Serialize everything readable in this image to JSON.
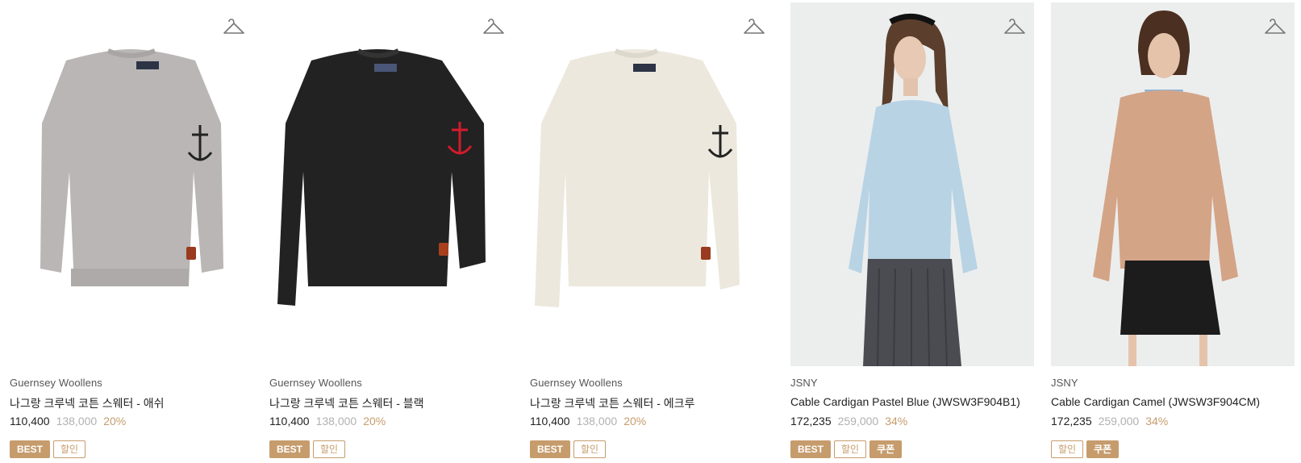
{
  "colors": {
    "accent": "#c69c6d",
    "muted": "#b1b1b1"
  },
  "products": [
    {
      "brand": "Guernsey Woollens",
      "name": "나그랑 크루넥 코튼 스웨터 - 애쉬",
      "price": "110,400",
      "original_price": "138,000",
      "discount": "20%",
      "tags": [
        {
          "label": "BEST",
          "style": "fill"
        },
        {
          "label": "할인",
          "style": "line"
        }
      ],
      "image": "grey-sweater-image",
      "wishlist_icon": "hanger-icon"
    },
    {
      "brand": "Guernsey Woollens",
      "name": "나그랑 크루넥 코튼 스웨터 - 블랙",
      "price": "110,400",
      "original_price": "138,000",
      "discount": "20%",
      "tags": [
        {
          "label": "BEST",
          "style": "fill"
        },
        {
          "label": "할인",
          "style": "line"
        }
      ],
      "image": "black-sweater-image",
      "wishlist_icon": "hanger-icon"
    },
    {
      "brand": "Guernsey Woollens",
      "name": "나그랑 크루넥 코튼 스웨터 - 에크루",
      "price": "110,400",
      "original_price": "138,000",
      "discount": "20%",
      "tags": [
        {
          "label": "BEST",
          "style": "fill"
        },
        {
          "label": "할인",
          "style": "line"
        }
      ],
      "image": "ecru-sweater-image",
      "wishlist_icon": "hanger-icon"
    },
    {
      "brand": "JSNY",
      "name": "Cable Cardigan Pastel Blue (JWSW3F904B1)",
      "price": "172,235",
      "original_price": "259,000",
      "discount": "34%",
      "tags": [
        {
          "label": "BEST",
          "style": "fill"
        },
        {
          "label": "할인",
          "style": "line"
        },
        {
          "label": "쿠폰",
          "style": "fill"
        }
      ],
      "image": "model-blue-cardigan-image",
      "wishlist_icon": "hanger-icon"
    },
    {
      "brand": "JSNY",
      "name": "Cable Cardigan Camel (JWSW3F904CM)",
      "price": "172,235",
      "original_price": "259,000",
      "discount": "34%",
      "tags": [
        {
          "label": "할인",
          "style": "line"
        },
        {
          "label": "쿠폰",
          "style": "fill"
        }
      ],
      "image": "model-camel-cardigan-image",
      "wishlist_icon": "hanger-icon"
    }
  ]
}
